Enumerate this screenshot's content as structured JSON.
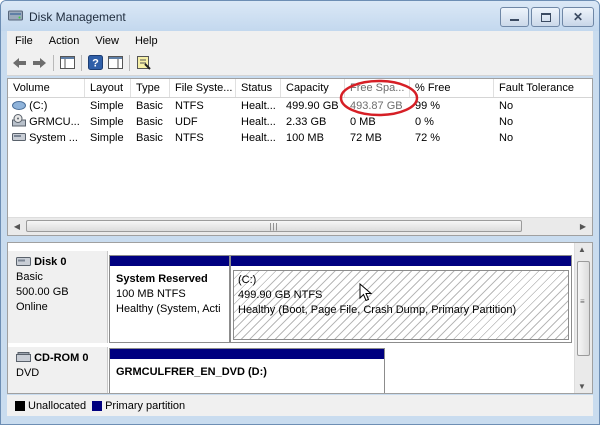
{
  "window": {
    "title": "Disk Management"
  },
  "menu": [
    "File",
    "Action",
    "View",
    "Help"
  ],
  "columns": [
    "Volume",
    "Layout",
    "Type",
    "File Syste...",
    "Status",
    "Capacity",
    "Free Spa...",
    "% Free",
    "Fault Tolerance"
  ],
  "volumes": [
    {
      "volume": "(C:)",
      "layout": "Simple",
      "type": "Basic",
      "fs": "NTFS",
      "status": "Healt...",
      "capacity": "499.90 GB",
      "free": "493.87 GB",
      "pct": "99 %",
      "fault": "No"
    },
    {
      "volume": "GRMCU...",
      "layout": "Simple",
      "type": "Basic",
      "fs": "UDF",
      "status": "Healt...",
      "capacity": "2.33 GB",
      "free": "0 MB",
      "pct": "0 %",
      "fault": "No"
    },
    {
      "volume": "System ...",
      "layout": "Simple",
      "type": "Basic",
      "fs": "NTFS",
      "status": "Healt...",
      "capacity": "100 MB",
      "free": "72 MB",
      "pct": "72 %",
      "fault": "No"
    }
  ],
  "disks": [
    {
      "name": "Disk 0",
      "type": "Basic",
      "size": "500.00 GB",
      "state": "Online",
      "partitions": [
        {
          "title": "System Reserved",
          "detail": "100 MB NTFS",
          "status": "Healthy (System, Acti"
        },
        {
          "title": "(C:)",
          "detail": "499.90 GB NTFS",
          "status": "Healthy (Boot, Page File, Crash Dump, Primary Partition)"
        }
      ]
    },
    {
      "name": "CD-ROM 0",
      "type": "DVD",
      "partitions": [
        {
          "title": "GRMCULFRER_EN_DVD (D:)"
        }
      ]
    }
  ],
  "legend": [
    {
      "label": "Unallocated",
      "color": "#000000"
    },
    {
      "label": "Primary partition",
      "color": "#000080"
    }
  ],
  "colors": {
    "primary_partition": "#000080",
    "highlight_circle": "#d61f26"
  },
  "icons": {
    "volume": [
      "drive-icon",
      "cd-drive-icon",
      "drive-icon"
    ]
  }
}
